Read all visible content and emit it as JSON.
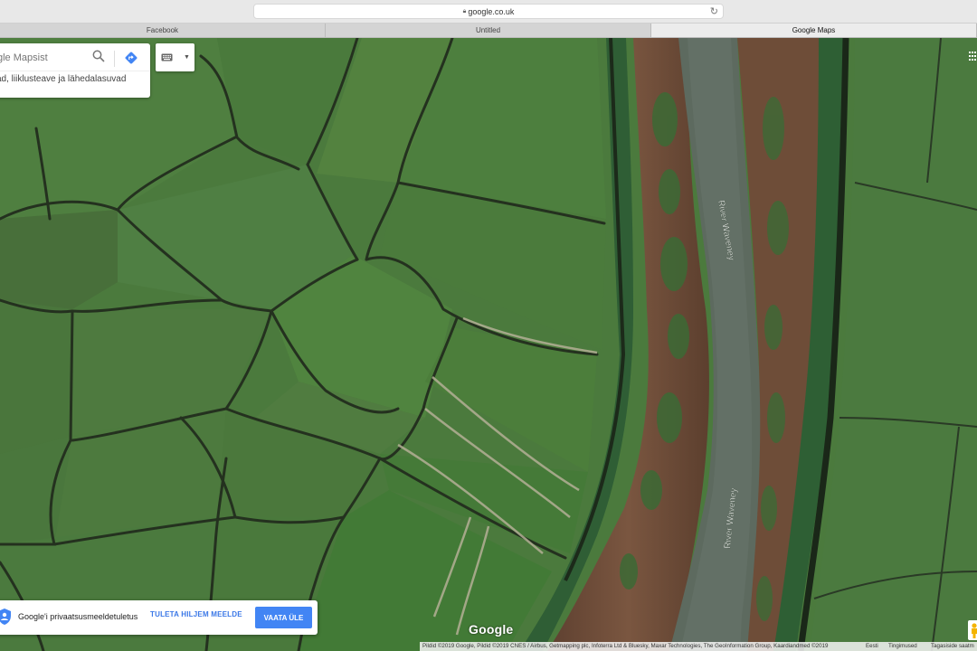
{
  "browser": {
    "url": "google.co.uk",
    "tabs": [
      {
        "label": "Facebook",
        "active": false
      },
      {
        "label": "Untitled",
        "active": false
      },
      {
        "label": "Google Maps",
        "active": true
      }
    ]
  },
  "search": {
    "placeholder": "gle Mapsist",
    "subtitle": "ad, liiklusteave ja lähedalasuvad"
  },
  "map": {
    "labels": [
      "River Waveney",
      "River Waveney"
    ],
    "logo": "Google"
  },
  "privacy": {
    "text": "Google'i privaatsusmeeldetuletus",
    "later_label": "TULETA HILJEM MEELDE",
    "accept_label": "VAATA ÜLE"
  },
  "footer": {
    "imagery": "Pildid ©2019 Google, Pildid ©2019 CNES / Airbus, Getmapping plc, Infoterra Ltd & Bluesky, Maxar Technologies, The GeoInformation Group, Kaardiandmed ©2019",
    "country": "Eesti",
    "terms": "Tingimused",
    "feedback": "Tagasiside saatm"
  },
  "colors": {
    "accent": "#4285f4",
    "link": "#3b78e7",
    "field": "#4d7a3e",
    "river": "#5c6b5f",
    "bank": "#6b4a36"
  }
}
